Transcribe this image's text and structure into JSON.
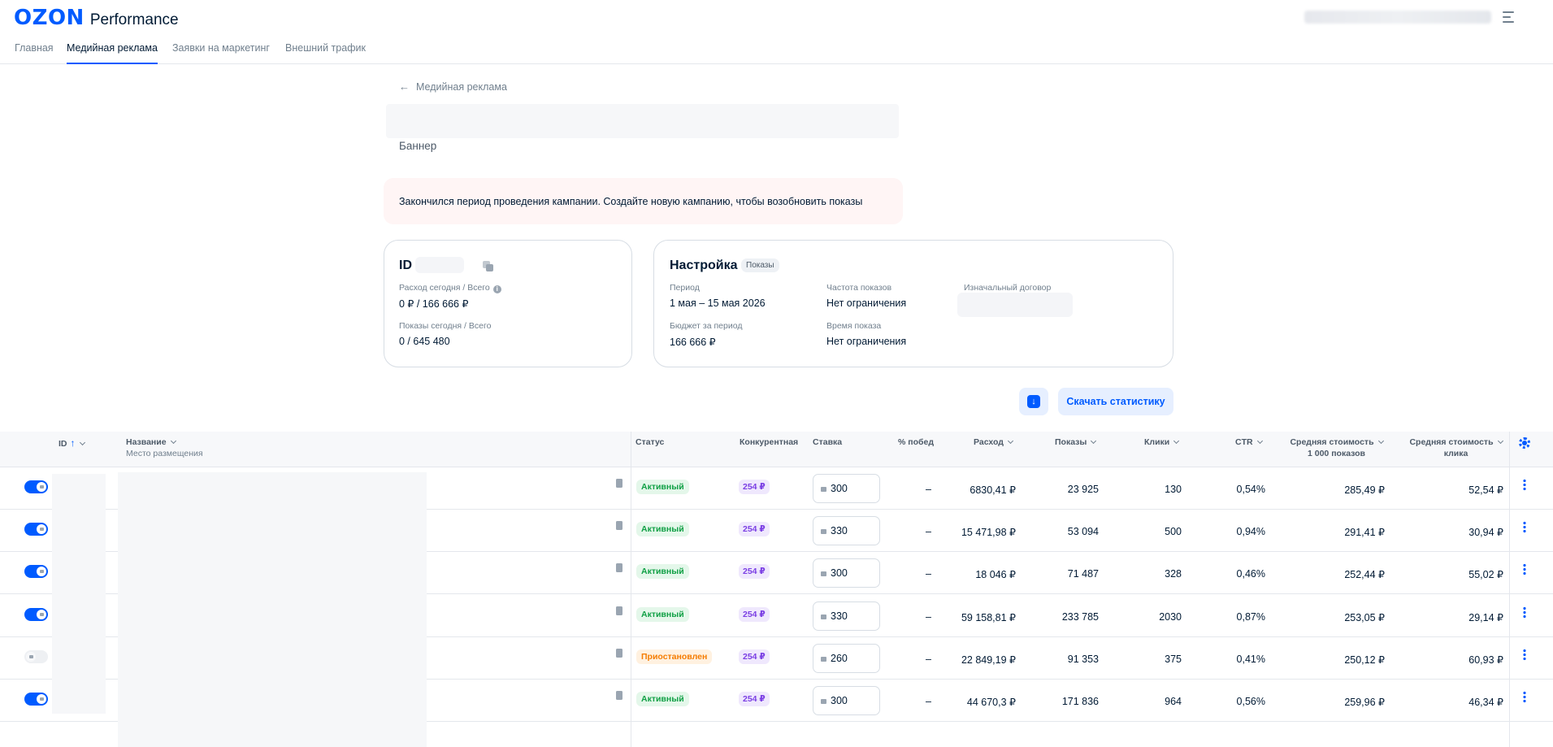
{
  "header": {
    "brand": "OZON",
    "product": "Performance"
  },
  "nav": {
    "tabs": [
      {
        "label": "Главная"
      },
      {
        "label": "Медийная реклама"
      },
      {
        "label": "Заявки на маркетинг"
      },
      {
        "label": "Внешний трафик"
      }
    ],
    "active": "Медийная реклама"
  },
  "campaign": {
    "back_label": "Медийная реклама",
    "type": "Баннер",
    "alert": "Закончился период проведения кампании. Создайте новую кампанию, чтобы возобновить показы"
  },
  "stats_card": {
    "title": "ID",
    "spend_label": "Расход сегодня / Всего",
    "spend_value": "0 ₽ / 166 666 ₽",
    "impr_label": "Показы сегодня / Всего",
    "impr_value": "0 / 645 480"
  },
  "settings_card": {
    "title": "Настройка",
    "badge": "Показы",
    "period_label": "Период",
    "period_value": "1 мая – 15 мая 2026",
    "budget_label": "Бюджет за период",
    "budget_value": "166 666 ₽",
    "freq_label": "Частота показов",
    "freq_value": "Нет ограничения",
    "time_label": "Время показа",
    "time_value": "Нет ограничения",
    "contract_label": "Изначальный договор"
  },
  "actions": {
    "download_stats": "Скачать статистику"
  },
  "table": {
    "headers": {
      "id": "ID",
      "name": "Название",
      "name_sub": "Место размещения",
      "status": "Статус",
      "competitive": "Конкурентная",
      "bid": "Ставка",
      "wins": "% побед",
      "spend": "Расход",
      "impressions": "Показы",
      "clicks": "Клики",
      "ctr": "CTR",
      "cpm": "Средняя стоимость",
      "cpm_sub": "1 000 показов",
      "cpc": "Средняя стоимость",
      "cpc_sub": "клика"
    },
    "rows": [
      {
        "enabled": true,
        "status": "Активный",
        "competitive": "254 ₽",
        "bid": "300",
        "wins": "–",
        "spend": "6830,41 ₽",
        "impressions": "23 925",
        "clicks": "130",
        "ctr": "0,54%",
        "cpm": "285,49 ₽",
        "cpc": "52,54 ₽"
      },
      {
        "enabled": true,
        "status": "Активный",
        "competitive": "254 ₽",
        "bid": "330",
        "wins": "–",
        "spend": "15 471,98 ₽",
        "impressions": "53 094",
        "clicks": "500",
        "ctr": "0,94%",
        "cpm": "291,41 ₽",
        "cpc": "30,94 ₽"
      },
      {
        "enabled": true,
        "status": "Активный",
        "competitive": "254 ₽",
        "bid": "300",
        "wins": "–",
        "spend": "18 046 ₽",
        "impressions": "71 487",
        "clicks": "328",
        "ctr": "0,46%",
        "cpm": "252,44 ₽",
        "cpc": "55,02 ₽"
      },
      {
        "enabled": true,
        "status": "Активный",
        "competitive": "254 ₽",
        "bid": "330",
        "wins": "–",
        "spend": "59 158,81 ₽",
        "impressions": "233 785",
        "clicks": "2030",
        "ctr": "0,87%",
        "cpm": "253,05 ₽",
        "cpc": "29,14 ₽"
      },
      {
        "enabled": false,
        "status": "Приостановлен",
        "competitive": "254 ₽",
        "bid": "260",
        "wins": "–",
        "spend": "22 849,19 ₽",
        "impressions": "91 353",
        "clicks": "375",
        "ctr": "0,41%",
        "cpm": "250,12 ₽",
        "cpc": "60,93 ₽"
      },
      {
        "enabled": true,
        "status": "Активный",
        "competitive": "254 ₽",
        "bid": "300",
        "wins": "–",
        "spend": "44 670,3 ₽",
        "impressions": "171 836",
        "clicks": "964",
        "ctr": "0,56%",
        "cpm": "259,96 ₽",
        "cpc": "46,34 ₽"
      }
    ]
  },
  "colors": {
    "accent": "#005bff",
    "active_badge": "#10a045",
    "paused_badge": "#f57c00",
    "competitive_badge": "#7b3fe4"
  }
}
